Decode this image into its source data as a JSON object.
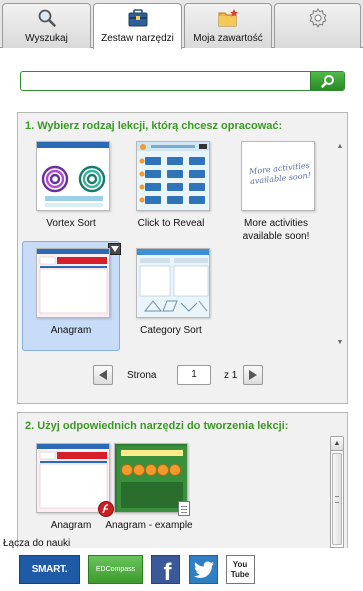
{
  "tabs": [
    {
      "label": "Wyszukaj",
      "icon": "magnifier-icon",
      "active": false
    },
    {
      "label": "Zestaw narzędzi",
      "icon": "toolbox-icon",
      "active": true
    },
    {
      "label": "Moja zawartość",
      "icon": "folder-star-icon",
      "active": false
    },
    {
      "label": "",
      "icon": "gear-icon",
      "active": false
    }
  ],
  "search": {
    "value": "",
    "placeholder": "",
    "button_icon": "search-icon"
  },
  "section1": {
    "title": "1. Wybierz rodzaj lekcji, którą chcesz opracować:",
    "activities": [
      {
        "label": "Vortex Sort"
      },
      {
        "label": "Click to Reveal"
      },
      {
        "label": "More activities available soon!",
        "thumb_text": "More activities available soon!"
      },
      {
        "label": "Anagram",
        "selected": true
      },
      {
        "label": "Category Sort"
      }
    ],
    "pager": {
      "page_label": "Strona",
      "page_value": "1",
      "of_label": "z 1"
    }
  },
  "section2": {
    "title": "2. Użyj odpowiednich narzędzi do tworzenia lekcji:",
    "items": [
      {
        "label": "Anagram",
        "badge_icon": "flash-icon"
      },
      {
        "label": "Anagram - example",
        "badge_icon": "document-icon"
      }
    ]
  },
  "learning_links_label": "Łącza do nauki",
  "footer": {
    "smart_label": "SMART.",
    "edcompass_label": "EDCompass",
    "facebook_label": "f",
    "youtube_label": "You Tube"
  },
  "colors": {
    "accent_green": "#3a9a24",
    "selection_blue": "#c7dcf6",
    "smart_blue": "#1f5aa7",
    "facebook_blue": "#3b5998",
    "twitter_blue": "#2f7fc2"
  }
}
